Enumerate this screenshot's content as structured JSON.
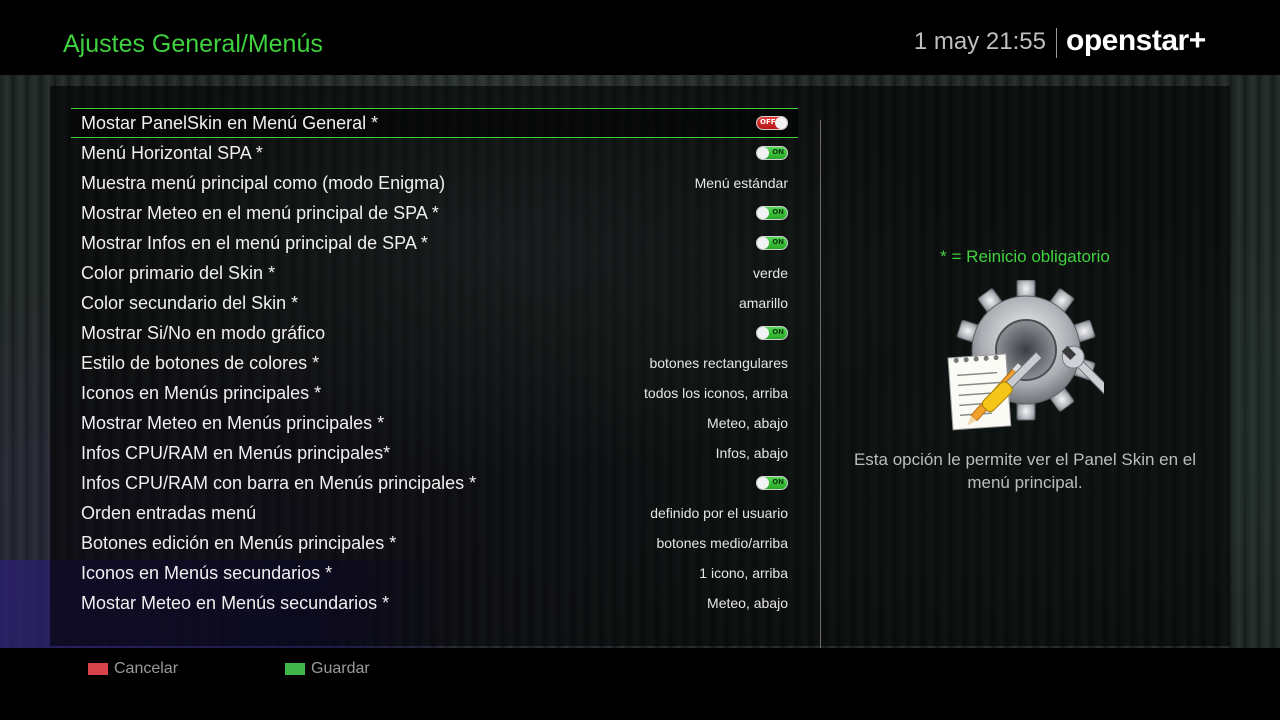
{
  "header": {
    "title": "Ajustes General/Menús",
    "clock": "1 may 21:55",
    "brand": "openstar+"
  },
  "colors": {
    "accent": "#3fd23f",
    "toggle_on": "#33bb33",
    "toggle_off": "#d42020",
    "key_red": "#d9434b",
    "key_green": "#3fb54a"
  },
  "settings": [
    {
      "label": "Mostar PanelSkin en Menú General *",
      "type": "toggle",
      "state": "off",
      "toggle_text": "OFF",
      "value": "",
      "selected": true
    },
    {
      "label": "Menú Horizontal SPA *",
      "type": "toggle",
      "state": "on",
      "toggle_text": "ON",
      "value": ""
    },
    {
      "label": "Muestra menú principal como (modo Enigma)",
      "type": "text",
      "value": "Menú estándar"
    },
    {
      "label": "Mostrar Meteo en el menú principal de SPA *",
      "type": "toggle",
      "state": "on",
      "toggle_text": "ON",
      "value": ""
    },
    {
      "label": "Mostrar Infos en el menú principal de SPA *",
      "type": "toggle",
      "state": "on",
      "toggle_text": "ON",
      "value": ""
    },
    {
      "label": "Color primario del Skin *",
      "type": "text",
      "value": "verde"
    },
    {
      "label": "Color secundario del Skin *",
      "type": "text",
      "value": "amarillo"
    },
    {
      "label": "Mostrar Si/No en modo gráfico",
      "type": "toggle",
      "state": "on",
      "toggle_text": "ON",
      "value": ""
    },
    {
      "label": "Estilo de botones de colores *",
      "type": "text",
      "value": "botones rectangulares"
    },
    {
      "label": "Iconos en Menús principales *",
      "type": "text",
      "value": "todos los iconos, arriba"
    },
    {
      "label": "Mostrar Meteo en Menús principales *",
      "type": "text",
      "value": "Meteo, abajo"
    },
    {
      "label": "Infos CPU/RAM en Menús principales*",
      "type": "text",
      "value": "Infos, abajo"
    },
    {
      "label": "Infos CPU/RAM con barra en Menús principales *",
      "type": "toggle",
      "state": "on",
      "toggle_text": "ON",
      "value": ""
    },
    {
      "label": "Orden entradas menú",
      "type": "text",
      "value": "definido por el usuario"
    },
    {
      "label": "Botones edición en Menús principales *",
      "type": "text",
      "value": "botones medio/arriba"
    },
    {
      "label": "Iconos en Menús secundarios *",
      "type": "text",
      "value": "1 icono, arriba"
    },
    {
      "label": "Mostar Meteo en Menús secundarios *",
      "type": "text",
      "value": "Meteo, abajo"
    }
  ],
  "info": {
    "heading": "* = Reinicio obligatorio",
    "icon": "settings-gear-tools-icon",
    "text": "Esta opción le permite ver el Panel Skin en el menú principal."
  },
  "footer": {
    "cancel_label": "Cancelar",
    "save_label": "Guardar"
  }
}
